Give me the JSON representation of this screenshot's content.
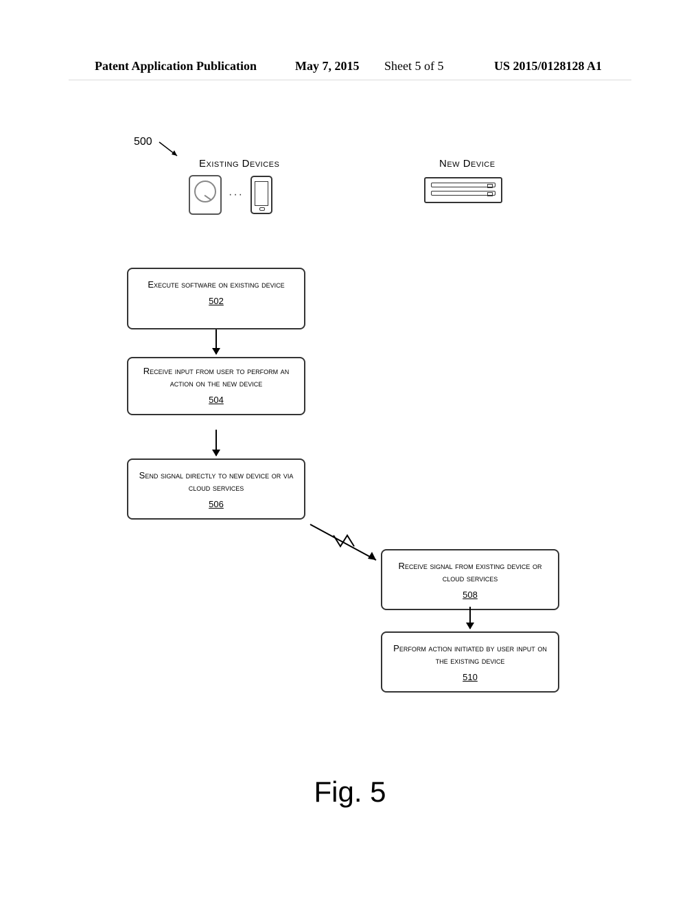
{
  "header": {
    "publication_label": "Patent Application Publication",
    "date": "May 7, 2015",
    "sheet": "Sheet 5 of 5",
    "pub_number": "US 2015/0128128 A1"
  },
  "figure": {
    "ref_number": "500",
    "caption": "Fig. 5",
    "columns": {
      "existing": "Existing Devices",
      "new": "New Device"
    },
    "devices": {
      "ellipsis": "···",
      "hdd_icon": "hard-disk-icon",
      "phone_icon": "phone-icon",
      "drive_icon": "media-drive-icon"
    },
    "steps": {
      "s502": {
        "text": "Execute software on existing device",
        "num": "502"
      },
      "s504": {
        "text": "Receive input from user to perform an action on the new device",
        "num": "504"
      },
      "s506": {
        "text": "Send signal directly to new device or via cloud services",
        "num": "506"
      },
      "s508": {
        "text": "Receive signal from existing device or cloud services",
        "num": "508"
      },
      "s510": {
        "text": "Perform action initiated by user input on the existing device",
        "num": "510"
      }
    }
  }
}
